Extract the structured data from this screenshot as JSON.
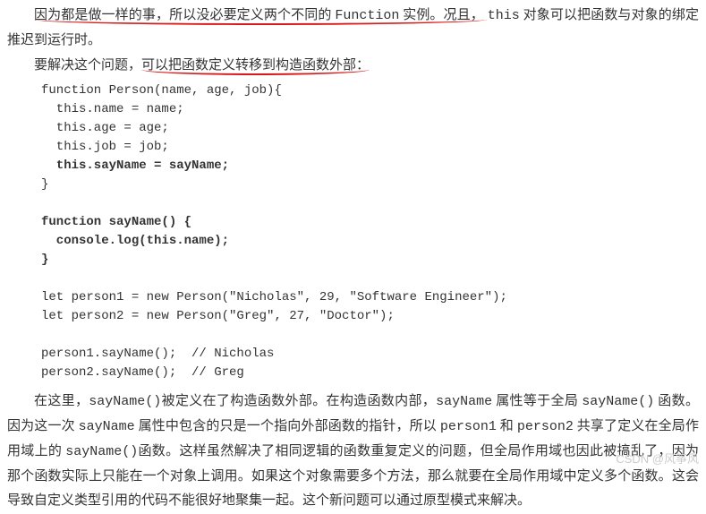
{
  "para1": {
    "seg1": "因为都是做一样的事，所以没必要定义两个不同的 ",
    "seg2_mono": "Function",
    "seg3": " 实例。况且，",
    "seg4": "this",
    "seg5": " 对象可以把函数与对象的绑定推迟到运行时。"
  },
  "para2": {
    "seg1": "要解决这个问题，",
    "seg2": "可以把函数定义转移到构造函数外部："
  },
  "code": {
    "l1": "function Person(name, age, job){",
    "l2": "  this.name = name;",
    "l3": "  this.age = age;",
    "l4": "  this.job = job;",
    "l5": "  this.sayName = sayName;",
    "l6": "}",
    "l7": "",
    "l8": "function sayName() {",
    "l9": "  console.log(this.name);",
    "l10": "}",
    "l11": "",
    "l12": "let person1 = new Person(\"Nicholas\", 29, \"Software Engineer\");",
    "l13": "let person2 = new Person(\"Greg\", 27, \"Doctor\");",
    "l14": "",
    "l15": "person1.sayName();  // Nicholas",
    "l16": "person2.sayName();  // Greg"
  },
  "para3": {
    "seg1": "在这里，",
    "f1": "sayName()",
    "seg2": "被定义在了构造函数外部。在构造函数内部，",
    "f2": "sayName",
    "seg3": " 属性等于全局 ",
    "f3": "sayName()",
    "seg4": " 函数。因为这一次 ",
    "f4": "sayName",
    "seg5": " 属性中包含的只是一个指向外部函数的指针，所以 ",
    "f5": "person1",
    "seg6": " 和 ",
    "f6": "person2",
    "seg7": " 共享了定义在全局作用域上的 ",
    "f7": "sayName()",
    "seg8": "函数。这样虽然解决了相同逻辑的函数重复定义的问题，但全局作用域也因此被搞乱了，因为那个函数实际上只能在一个对象上调用。如果这个对象需要多个方法，那么就要在全局作用域中定义多个函数。这会导致自定义类型引用的代码不能很好地聚集一起。这个新问题可以通过原型模式来解决。"
  },
  "watermark": "CSDN @风筝风"
}
